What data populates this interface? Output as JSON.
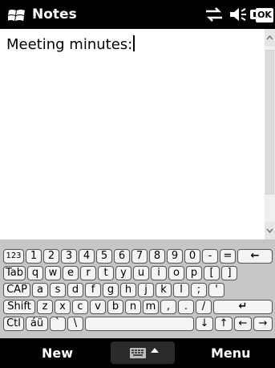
{
  "title_bar": {
    "title": "Notes",
    "ok_label": "OK",
    "icons": [
      "windows-logo-icon",
      "connectivity-icon",
      "volume-icon",
      "battery-icon"
    ]
  },
  "editor": {
    "text": "Meeting minutes:"
  },
  "keyboard": {
    "rows": [
      [
        "123",
        "1",
        "2",
        "3",
        "4",
        "5",
        "6",
        "7",
        "8",
        "9",
        "0",
        "-",
        "=",
        "←"
      ],
      [
        "Tab",
        "q",
        "w",
        "e",
        "r",
        "t",
        "y",
        "u",
        "i",
        "o",
        "p",
        "[",
        "]"
      ],
      [
        "CAP",
        "a",
        "s",
        "d",
        "f",
        "g",
        "h",
        "j",
        "k",
        "l",
        ";",
        "'"
      ],
      [
        "Shift",
        "z",
        "x",
        "c",
        "v",
        "b",
        "n",
        "m",
        ",",
        ".",
        "/",
        "↵"
      ],
      [
        "Ctl",
        "áü",
        "`",
        "\\",
        "",
        "↓",
        "↑",
        "←",
        "→"
      ]
    ]
  },
  "bottom_bar": {
    "left_softkey": "New",
    "right_softkey": "Menu"
  },
  "colors": {
    "bar_background": "#000000",
    "keyboard_background": "#c6c6c6",
    "key_face": "#f4f4f4"
  }
}
